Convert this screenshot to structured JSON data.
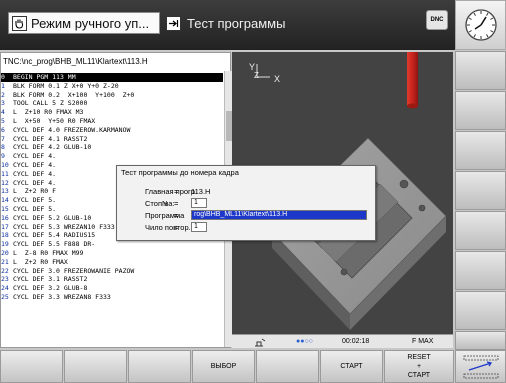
{
  "header": {
    "mode_left": "Режим ручного уп...",
    "mode_right": "Тест программы",
    "dnc_label": "DNC"
  },
  "program": {
    "path": "TNC:\\nc_prog\\BHB_ML11\\Klartext\\113.H",
    "lines": [
      {
        "n": "0",
        "text": "BEGIN PGM 113 MM"
      },
      {
        "n": "1",
        "text": "BLK FORM 0.1 Z X+0 Y+0 Z-20"
      },
      {
        "n": "2",
        "text": "BLK FORM 0.2  X+100  Y+100  Z+0"
      },
      {
        "n": "3",
        "text": "TOOL CALL 5 Z S2000"
      },
      {
        "n": "4",
        "text": "L  Z+10 R0 FMAX M3"
      },
      {
        "n": "5",
        "text": "L  X+50  Y+50 R0 FMAX"
      },
      {
        "n": "6",
        "text": "CYCL DEF 4.0 FREZEROW.KARMANOW"
      },
      {
        "n": "7",
        "text": "CYCL DEF 4.1 RASST2"
      },
      {
        "n": "8",
        "text": "CYCL DEF 4.2 GLUB-10"
      },
      {
        "n": "9",
        "text": "CYCL DEF 4."
      },
      {
        "n": "10",
        "text": "CYCL DEF 4."
      },
      {
        "n": "11",
        "text": "CYCL DEF 4."
      },
      {
        "n": "12",
        "text": "CYCL DEF 4."
      },
      {
        "n": "13",
        "text": "L  Z+2 R0 F"
      },
      {
        "n": "14",
        "text": "CYCL DEF 5."
      },
      {
        "n": "15",
        "text": "CYCL DEF 5."
      },
      {
        "n": "16",
        "text": "CYCL DEF 5.2 GLUB-10"
      },
      {
        "n": "17",
        "text": "CYCL DEF 5.3 WREZAN10 F333"
      },
      {
        "n": "18",
        "text": "CYCL DEF 5.4 RADIUS15"
      },
      {
        "n": "19",
        "text": "CYCL DEF 5.5 F888 DR-"
      },
      {
        "n": "20",
        "text": "L  Z-8 R0 FMAX M99"
      },
      {
        "n": "21",
        "text": "L  Z+2 R0 FMAX"
      },
      {
        "n": "22",
        "text": "CYCL DEF 3.0 FREZEROWANIE PAZOW"
      },
      {
        "n": "23",
        "text": "CYCL DEF 3.1 RASST2"
      },
      {
        "n": "24",
        "text": "CYCL DEF 3.2 GLUB-8"
      },
      {
        "n": "25",
        "text": "CYCL DEF 3.3 WREZAN8 F333"
      }
    ]
  },
  "dialog": {
    "title": "Тест программы до номера кадра",
    "main_prog_label": "Главная прогр.",
    "main_prog_value": "113.H",
    "stop_label": "Стоп на:",
    "stop_n_label": "N",
    "stop_value": "1",
    "program_label": "Программа",
    "program_value": "rog\\BHB_ML11\\Klartext\\113.H",
    "repeat_label": "Чило повтор.",
    "repeat_value": "1",
    "eq": "="
  },
  "graphic": {
    "axis_y": "Y",
    "axis_z": "Z",
    "axis_x": "X"
  },
  "status": {
    "time": "00:02:18",
    "feed": "F MAX"
  },
  "softkeys": {
    "select": "ВЫБОР",
    "start": "СТАРТ",
    "reset_start": "RESET\n+\nСТАРТ"
  },
  "colors": {
    "selection": "#1d38c8",
    "workpiece": "#8e8e8e",
    "tool": "#c8231c"
  }
}
